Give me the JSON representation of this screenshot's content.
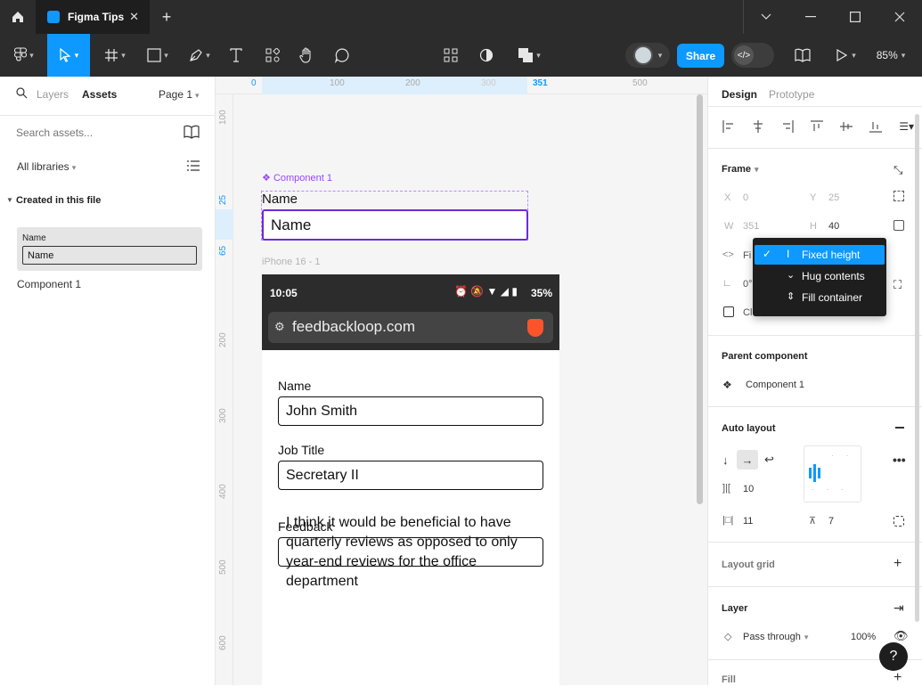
{
  "titlebar": {
    "tab_title": "Figma Tips",
    "new_tab": "+"
  },
  "toolbar": {
    "share_label": "Share",
    "zoom": "85%",
    "code_label": "</>"
  },
  "left_panel": {
    "tab_layers": "Layers",
    "tab_assets": "Assets",
    "page": "Page 1",
    "search_placeholder": "Search assets...",
    "libraries": "All libraries",
    "section_title": "Created in this file",
    "thumb_label": "Name",
    "thumb_field": "Name",
    "component_name": "Component 1"
  },
  "ruler": {
    "top": [
      "0",
      "100",
      "200",
      "300",
      "351",
      "500"
    ],
    "left": [
      "100",
      "25",
      "65",
      "200",
      "300",
      "400",
      "500",
      "600"
    ]
  },
  "canvas": {
    "component_label": "Component 1",
    "component_field_label": "Name",
    "component_field_value": "Name",
    "frame_label": "iPhone 16 - 1",
    "phone": {
      "time": "10:05",
      "battery": "35%",
      "url": "feedbackloop.com",
      "name_label": "Name",
      "name_value": "John Smith",
      "job_label": "Job Title",
      "job_value": "Secretary II",
      "feedback_label": "Feedback",
      "feedback_value": "I think it would be beneficial to have quarterly reviews as opposed to only year-end reviews for the office department"
    }
  },
  "right_panel": {
    "tab_design": "Design",
    "tab_prototype": "Prototype",
    "frame_title": "Frame",
    "x_label": "X",
    "x_value": "0",
    "y_label": "Y",
    "y_value": "25",
    "w_label": "W",
    "w_value": "351",
    "h_label": "H",
    "h_value": "40",
    "fixed_partial": "Fi",
    "rot_partial": "0°",
    "clip_partial": "Cl",
    "dropdown": [
      "Fixed height",
      "Hug contents",
      "Fill container"
    ],
    "parent_component_title": "Parent component",
    "parent_component_name": "Component 1",
    "auto_layout_title": "Auto layout",
    "gap": "10",
    "padding_h": "11",
    "padding_v": "7",
    "layout_grid_title": "Layout grid",
    "layer_title": "Layer",
    "blend_mode": "Pass through",
    "opacity": "100%",
    "fill_title": "Fill",
    "help": "?"
  },
  "colors": {
    "accent": "#0d99ff",
    "component": "#9747ff",
    "dark": "#2c2c2c"
  }
}
